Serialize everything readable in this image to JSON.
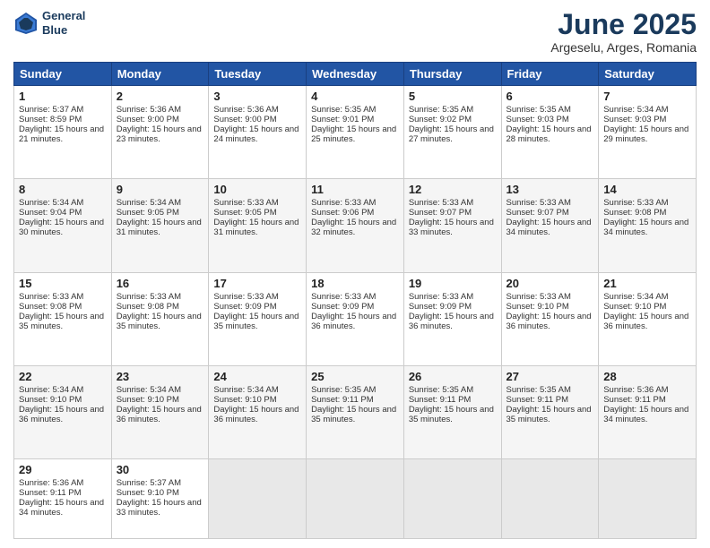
{
  "header": {
    "logo_line1": "General",
    "logo_line2": "Blue",
    "month_title": "June 2025",
    "location": "Argeselu, Arges, Romania"
  },
  "days_of_week": [
    "Sunday",
    "Monday",
    "Tuesday",
    "Wednesday",
    "Thursday",
    "Friday",
    "Saturday"
  ],
  "weeks": [
    [
      {
        "day": 1,
        "sunrise": "5:37 AM",
        "sunset": "8:59 PM",
        "daylight": "15 hours and 21 minutes."
      },
      {
        "day": 2,
        "sunrise": "5:36 AM",
        "sunset": "9:00 PM",
        "daylight": "15 hours and 23 minutes."
      },
      {
        "day": 3,
        "sunrise": "5:36 AM",
        "sunset": "9:00 PM",
        "daylight": "15 hours and 24 minutes."
      },
      {
        "day": 4,
        "sunrise": "5:35 AM",
        "sunset": "9:01 PM",
        "daylight": "15 hours and 25 minutes."
      },
      {
        "day": 5,
        "sunrise": "5:35 AM",
        "sunset": "9:02 PM",
        "daylight": "15 hours and 27 minutes."
      },
      {
        "day": 6,
        "sunrise": "5:35 AM",
        "sunset": "9:03 PM",
        "daylight": "15 hours and 28 minutes."
      },
      {
        "day": 7,
        "sunrise": "5:34 AM",
        "sunset": "9:03 PM",
        "daylight": "15 hours and 29 minutes."
      }
    ],
    [
      {
        "day": 8,
        "sunrise": "5:34 AM",
        "sunset": "9:04 PM",
        "daylight": "15 hours and 30 minutes."
      },
      {
        "day": 9,
        "sunrise": "5:34 AM",
        "sunset": "9:05 PM",
        "daylight": "15 hours and 31 minutes."
      },
      {
        "day": 10,
        "sunrise": "5:33 AM",
        "sunset": "9:05 PM",
        "daylight": "15 hours and 31 minutes."
      },
      {
        "day": 11,
        "sunrise": "5:33 AM",
        "sunset": "9:06 PM",
        "daylight": "15 hours and 32 minutes."
      },
      {
        "day": 12,
        "sunrise": "5:33 AM",
        "sunset": "9:07 PM",
        "daylight": "15 hours and 33 minutes."
      },
      {
        "day": 13,
        "sunrise": "5:33 AM",
        "sunset": "9:07 PM",
        "daylight": "15 hours and 34 minutes."
      },
      {
        "day": 14,
        "sunrise": "5:33 AM",
        "sunset": "9:08 PM",
        "daylight": "15 hours and 34 minutes."
      }
    ],
    [
      {
        "day": 15,
        "sunrise": "5:33 AM",
        "sunset": "9:08 PM",
        "daylight": "15 hours and 35 minutes."
      },
      {
        "day": 16,
        "sunrise": "5:33 AM",
        "sunset": "9:08 PM",
        "daylight": "15 hours and 35 minutes."
      },
      {
        "day": 17,
        "sunrise": "5:33 AM",
        "sunset": "9:09 PM",
        "daylight": "15 hours and 35 minutes."
      },
      {
        "day": 18,
        "sunrise": "5:33 AM",
        "sunset": "9:09 PM",
        "daylight": "15 hours and 36 minutes."
      },
      {
        "day": 19,
        "sunrise": "5:33 AM",
        "sunset": "9:09 PM",
        "daylight": "15 hours and 36 minutes."
      },
      {
        "day": 20,
        "sunrise": "5:33 AM",
        "sunset": "9:10 PM",
        "daylight": "15 hours and 36 minutes."
      },
      {
        "day": 21,
        "sunrise": "5:34 AM",
        "sunset": "9:10 PM",
        "daylight": "15 hours and 36 minutes."
      }
    ],
    [
      {
        "day": 22,
        "sunrise": "5:34 AM",
        "sunset": "9:10 PM",
        "daylight": "15 hours and 36 minutes."
      },
      {
        "day": 23,
        "sunrise": "5:34 AM",
        "sunset": "9:10 PM",
        "daylight": "15 hours and 36 minutes."
      },
      {
        "day": 24,
        "sunrise": "5:34 AM",
        "sunset": "9:10 PM",
        "daylight": "15 hours and 36 minutes."
      },
      {
        "day": 25,
        "sunrise": "5:35 AM",
        "sunset": "9:11 PM",
        "daylight": "15 hours and 35 minutes."
      },
      {
        "day": 26,
        "sunrise": "5:35 AM",
        "sunset": "9:11 PM",
        "daylight": "15 hours and 35 minutes."
      },
      {
        "day": 27,
        "sunrise": "5:35 AM",
        "sunset": "9:11 PM",
        "daylight": "15 hours and 35 minutes."
      },
      {
        "day": 28,
        "sunrise": "5:36 AM",
        "sunset": "9:11 PM",
        "daylight": "15 hours and 34 minutes."
      }
    ],
    [
      {
        "day": 29,
        "sunrise": "5:36 AM",
        "sunset": "9:11 PM",
        "daylight": "15 hours and 34 minutes."
      },
      {
        "day": 30,
        "sunrise": "5:37 AM",
        "sunset": "9:10 PM",
        "daylight": "15 hours and 33 minutes."
      },
      null,
      null,
      null,
      null,
      null
    ]
  ]
}
